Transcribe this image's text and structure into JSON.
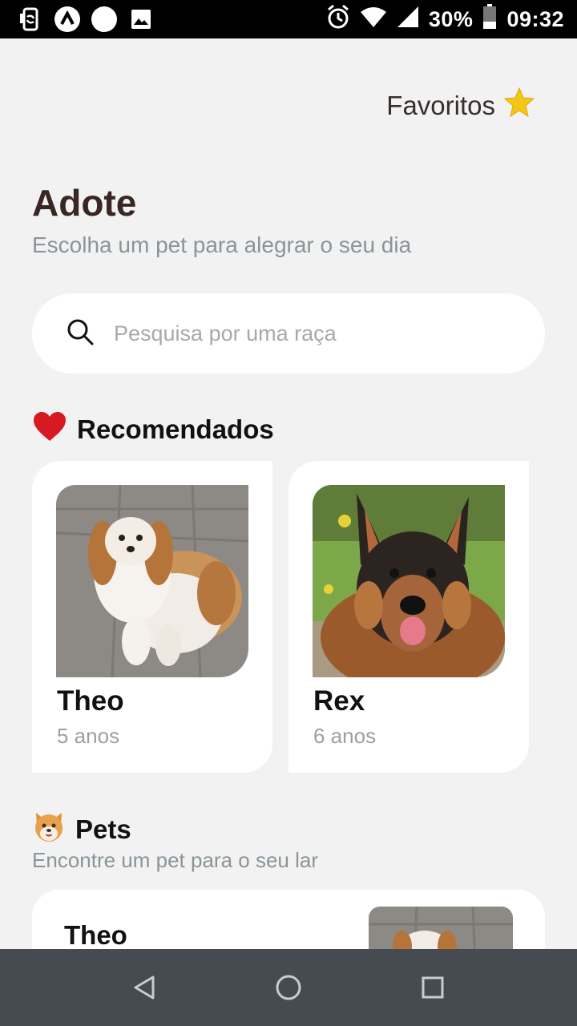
{
  "status_bar": {
    "battery": "30%",
    "time": "09:32",
    "left_icons": [
      "screen-rotate-icon",
      "app-lambda-icon",
      "circle-notification-icon",
      "image-icon"
    ],
    "right_icons": [
      "alarm-icon",
      "wifi-icon",
      "signal-icon",
      "battery-icon"
    ]
  },
  "header": {
    "favorites_label": "Favoritos",
    "favorites_icon": "star-icon"
  },
  "page": {
    "title": "Adote",
    "subtitle": "Escolha um pet para alegrar o seu dia"
  },
  "search": {
    "placeholder": "Pesquisa por uma raça",
    "icon": "search-icon"
  },
  "recommended": {
    "title": "Recomendados",
    "icon": "heart-icon",
    "pets": [
      {
        "name": "Theo",
        "age": "5 anos",
        "photo": "shih-tzu-photo"
      },
      {
        "name": "Rex",
        "age": "6 anos",
        "photo": "german-shepherd-photo"
      }
    ]
  },
  "pets": {
    "title": "Pets",
    "icon": "dog-face-icon",
    "subtitle": "Encontre um pet para o seu lar",
    "items": [
      {
        "name": "Theo",
        "photo": "shih-tzu-photo"
      }
    ]
  },
  "nav": {
    "icons": [
      "back-icon",
      "home-icon",
      "recents-icon"
    ]
  },
  "colors": {
    "title": "#3a2624",
    "muted": "#8a9499",
    "star": "#f5c518",
    "heart": "#d71921",
    "navbar": "#454b51"
  }
}
